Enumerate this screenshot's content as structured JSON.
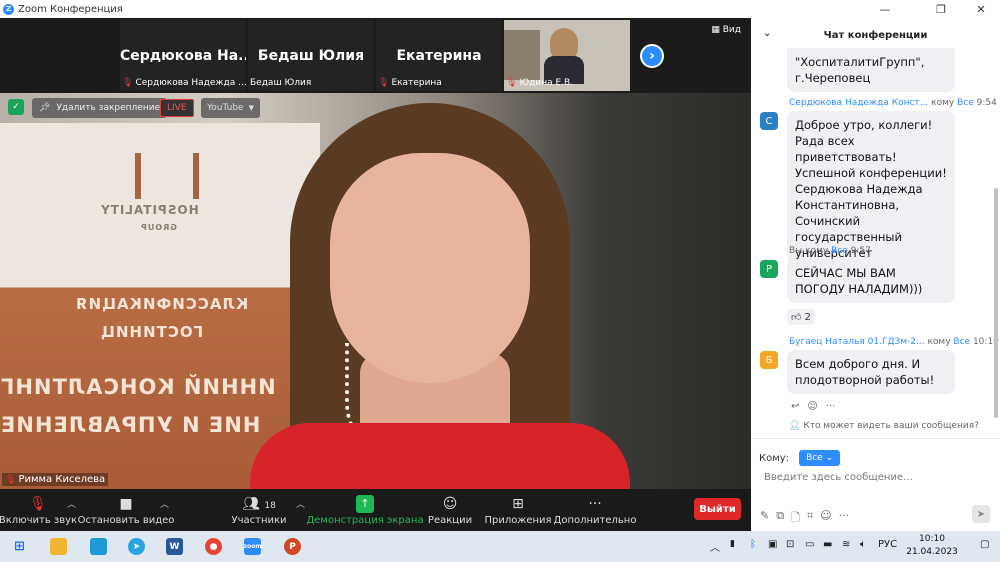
{
  "window": {
    "title": "Zoom Конференция"
  },
  "strip": {
    "thumbs": [
      {
        "name": "Сердюкова  На...",
        "label": "Сердюкова Надежда ..."
      },
      {
        "name": "Бедаш Юлия",
        "label": "Бедаш Юлия"
      },
      {
        "name": "Екатерина",
        "label": "Екатерина"
      },
      {
        "name": "",
        "label": "Юдина Е.В."
      }
    ],
    "view_label": "Вид"
  },
  "video": {
    "unpin_label": "Удалить закрепление",
    "live_label": "LIVE",
    "youtube_label": "YouTube",
    "speaker_name": "Римма Киселева",
    "banner_lines": [
      "HOSPITALITY",
      "GROUP",
      "КЛАССИФИКАЦИЯ",
      "ГОСТИНИЦ",
      "ИННИЙ КОНСАЛТИНГ",
      "НИЕ И УПРАВЛЕНИЕ"
    ]
  },
  "toolbar": {
    "unmute": "Включить звук",
    "stop_video": "Остановить видео",
    "participants": "Участники",
    "participants_count": "18",
    "share": "Демонстрация экрана",
    "reactions": "Реакции",
    "apps": "Приложения",
    "more": "Дополнительно",
    "leave": "Выйти"
  },
  "chat": {
    "title": "Чат конференции",
    "messages": [
      {
        "text": "\"ХоспиталитиГрупп\", г.Череповец"
      },
      {
        "avatar": "С",
        "avatar_color": "#2a7fc9",
        "from": "Сердюкова Надежда Конст...",
        "to_prefix": "кому",
        "to": "Все",
        "time": "9:54",
        "text": "Доброе утро, коллеги! Рада всех приветствовать! Успешной конференции! Сердюкова Надежда Константиновна, Сочинский государственный университет"
      },
      {
        "avatar": "Р",
        "avatar_color": "#1aa55a",
        "from": "Вы",
        "to_prefix": "кому",
        "to": "Все",
        "time": "9:57",
        "text": "СЕЙЧАС МЫ ВАМ ПОГОДУ НАЛАДИМ)))"
      },
      {
        "avatar": "Б",
        "avatar_color": "#f5a623",
        "from": "Бугаец Наталья 01.ГДЗм-2...",
        "to_prefix": "кому",
        "to": "Все",
        "time": "10:10",
        "text": "Всем доброго дня. И плодотворной работы!"
      }
    ],
    "reaction": "2",
    "who_can_see": "Кто может видеть ваши сообщения?",
    "to_label": "Кому:",
    "to_value": "Все",
    "input_placeholder": "Введите здесь сообщение..."
  },
  "taskbar": {
    "lang": "РУС",
    "time": "10:10",
    "date": "21.04.2023"
  }
}
